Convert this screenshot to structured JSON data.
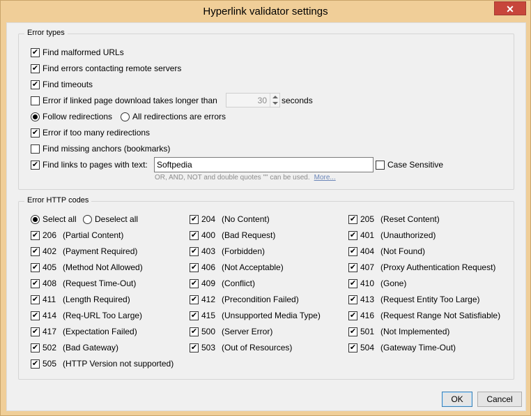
{
  "window": {
    "title": "Hyperlink validator settings",
    "close_label": "✕"
  },
  "error_types": {
    "legend": "Error types",
    "malformed": "Find malformed URLs",
    "contacting": "Find errors contacting remote servers",
    "timeouts": "Find timeouts",
    "download_longer": "Error if linked page download takes longer than",
    "download_seconds_value": "30",
    "seconds_label": "seconds",
    "follow_redirections": "Follow redirections",
    "all_redirections": "All redirections are errors",
    "too_many_redirections": "Error if too many redirections",
    "missing_anchors": "Find missing anchors (bookmarks)",
    "links_with_text": "Find links to pages with text:",
    "search_text_value": "Softpedia",
    "case_sensitive": "Case Sensitive",
    "hint": "OR, AND, NOT and double quotes \"\" can be used.",
    "more_link": "More..."
  },
  "http_codes": {
    "legend": "Error HTTP codes",
    "select_all": "Select all",
    "deselect_all": "Deselect all",
    "col1": [
      {
        "code": "206",
        "text": "(Partial Content)"
      },
      {
        "code": "402",
        "text": "(Payment Required)"
      },
      {
        "code": "405",
        "text": "(Method Not Allowed)"
      },
      {
        "code": "408",
        "text": "(Request Time-Out)"
      },
      {
        "code": "411",
        "text": "(Length Required)"
      },
      {
        "code": "414",
        "text": "(Req-URL Too Large)"
      },
      {
        "code": "417",
        "text": "(Expectation Failed)"
      },
      {
        "code": "502",
        "text": "(Bad Gateway)"
      },
      {
        "code": "505",
        "text": "(HTTP Version not supported)"
      }
    ],
    "col2": [
      {
        "code": "204",
        "text": "(No Content)"
      },
      {
        "code": "400",
        "text": "(Bad Request)"
      },
      {
        "code": "403",
        "text": "(Forbidden)"
      },
      {
        "code": "406",
        "text": "(Not Acceptable)"
      },
      {
        "code": "409",
        "text": "(Conflict)"
      },
      {
        "code": "412",
        "text": "(Precondition Failed)"
      },
      {
        "code": "415",
        "text": "(Unsupported Media Type)"
      },
      {
        "code": "500",
        "text": "(Server Error)"
      },
      {
        "code": "503",
        "text": "(Out of Resources)"
      }
    ],
    "col3": [
      {
        "code": "205",
        "text": "(Reset Content)"
      },
      {
        "code": "401",
        "text": "(Unauthorized)"
      },
      {
        "code": "404",
        "text": "(Not Found)"
      },
      {
        "code": "407",
        "text": "(Proxy Authentication Request)"
      },
      {
        "code": "410",
        "text": "(Gone)"
      },
      {
        "code": "413",
        "text": "(Request Entity Too Large)"
      },
      {
        "code": "416",
        "text": "(Request Range Not Satisfiable)"
      },
      {
        "code": "501",
        "text": "(Not Implemented)"
      },
      {
        "code": "504",
        "text": "(Gateway Time-Out)"
      }
    ]
  },
  "buttons": {
    "ok": "OK",
    "cancel": "Cancel"
  },
  "colors": {
    "titlebar": "#f0ce98",
    "close": "#c7463b",
    "dialog": "#f0f0f0"
  }
}
